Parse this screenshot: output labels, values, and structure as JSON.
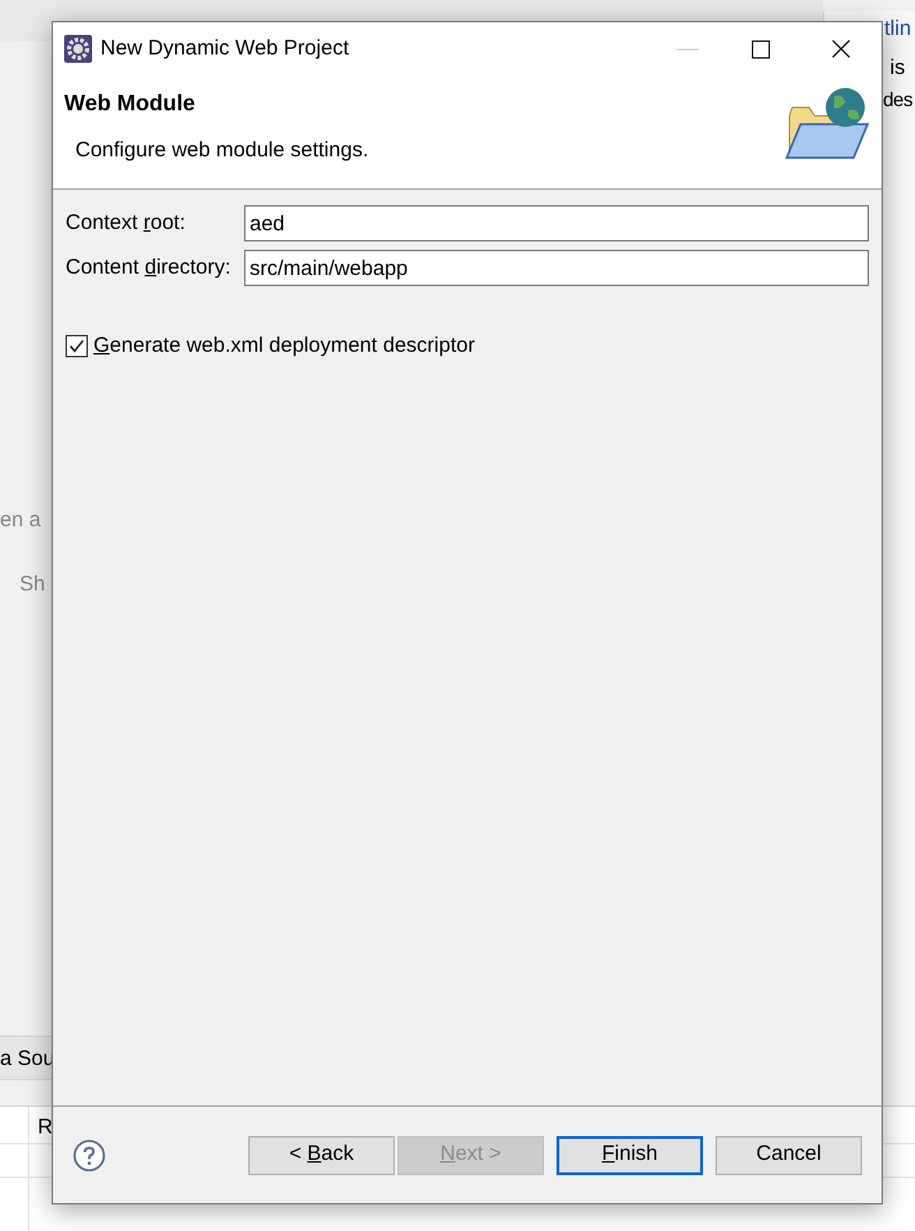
{
  "background": {
    "fragments": [
      {
        "kind": "right",
        "text": "tlin"
      },
      {
        "kind": "right",
        "text": "is"
      },
      {
        "kind": "right",
        "text": "des"
      },
      {
        "kind": "left",
        "text": "en a"
      },
      {
        "kind": "left2",
        "text": "Sh"
      },
      {
        "kind": "tab",
        "text": "a Sou"
      },
      {
        "kind": "cell",
        "text": "R"
      }
    ]
  },
  "dialog": {
    "title": "New Dynamic Web Project",
    "header": {
      "title": "Web Module",
      "description": "Configure web module settings."
    },
    "fields": [
      {
        "label": {
          "before": "Context ",
          "mnemonic": "r",
          "after": "oot:"
        },
        "value": "aed"
      },
      {
        "label": {
          "before": "Content ",
          "mnemonic": "d",
          "after": "irectory:"
        },
        "value": "src/main/webapp"
      }
    ],
    "checkbox": {
      "label": {
        "mnemonic": "G",
        "after": "enerate web.xml deployment descriptor"
      },
      "checked": true
    },
    "buttons": [
      {
        "label": {
          "before": "< ",
          "mnemonic": "B",
          "after": "ack"
        },
        "disabled": false,
        "default": false
      },
      {
        "label": {
          "mnemonic": "N",
          "after": "ext >"
        },
        "disabled": true,
        "default": false
      },
      {
        "label": {
          "mnemonic": "F",
          "after": "inish"
        },
        "disabled": false,
        "default": true
      },
      {
        "label": {
          "before": "Cancel"
        },
        "disabled": false,
        "default": false
      }
    ]
  }
}
